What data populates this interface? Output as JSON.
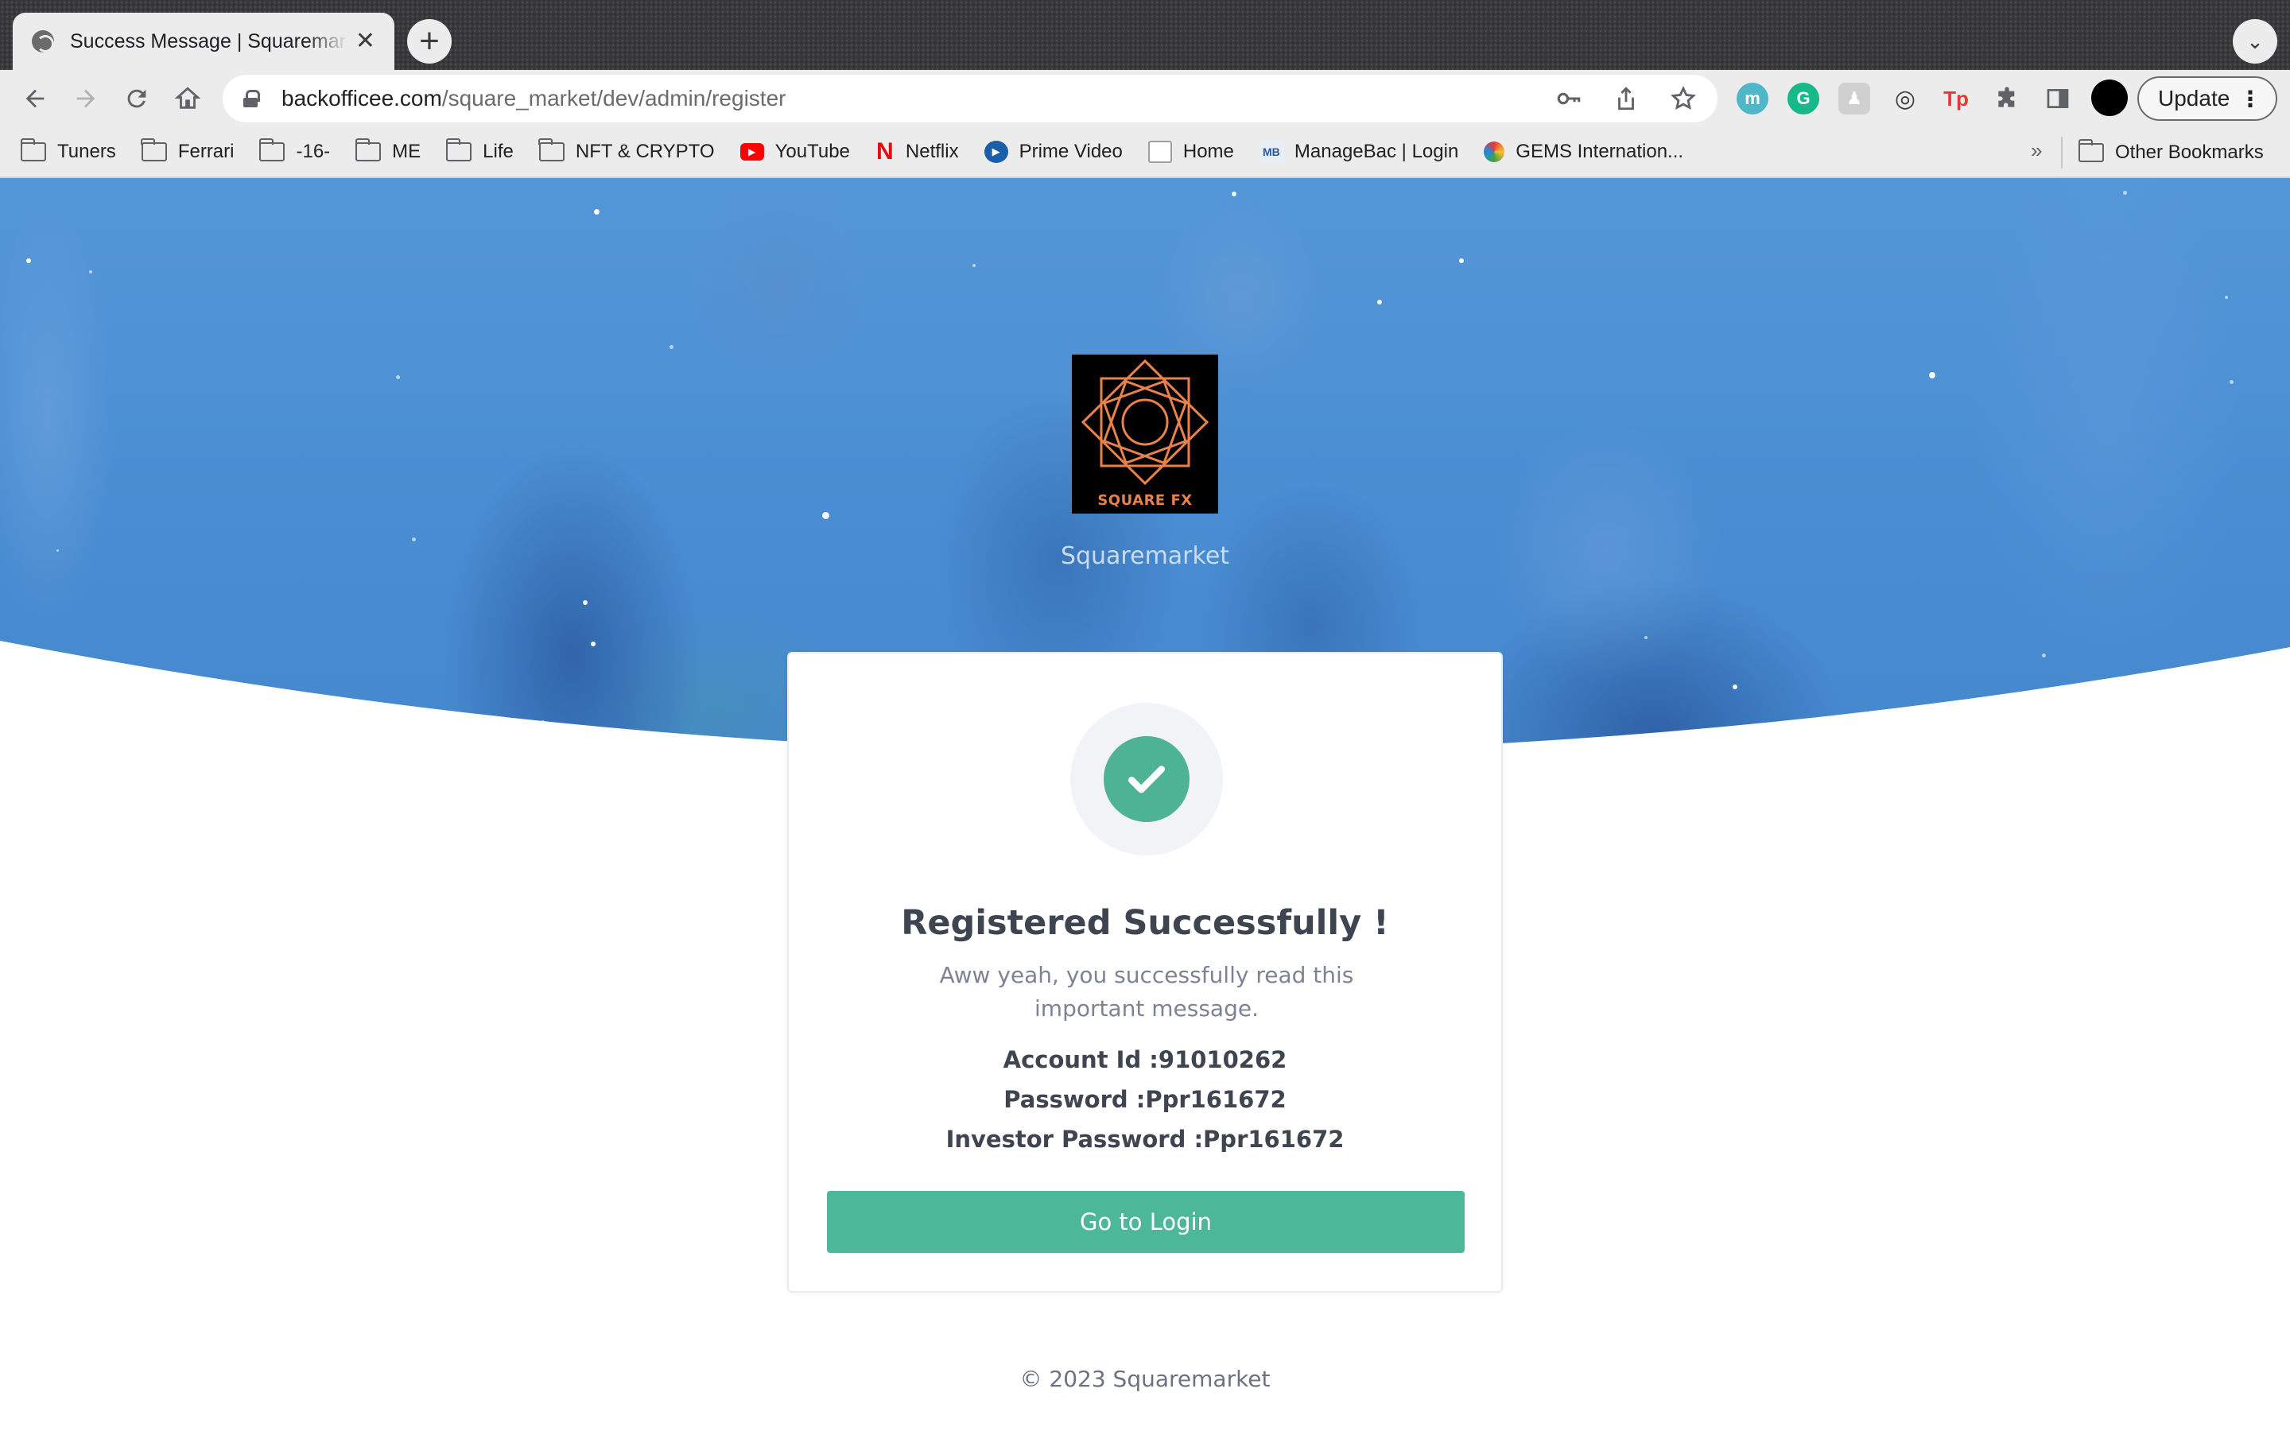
{
  "browser": {
    "tab_title": "Success Message | Squaremarket",
    "tab_close": "✕",
    "new_tab": "+",
    "tab_menu": "⌄",
    "url_host": "backofficee.com",
    "url_path": "/square_market/dev/admin/register",
    "update_label": "Update",
    "menu_dots": "⋮",
    "extensions": [
      {
        "name": "m",
        "color": "#4fb7c8"
      },
      {
        "name": "G",
        "color": "#17b889"
      },
      {
        "name": "♟",
        "color": "#9aa0a6"
      },
      {
        "name": "◎",
        "color": "#3c3c3c"
      },
      {
        "name": "Tp",
        "color": "#e53935"
      }
    ]
  },
  "bookmarks": {
    "items": [
      {
        "label": "Tuners",
        "icon": "folder-icon"
      },
      {
        "label": "Ferrari",
        "icon": "folder-icon"
      },
      {
        "label": "-16-",
        "icon": "folder-icon"
      },
      {
        "label": "ME",
        "icon": "folder-icon"
      },
      {
        "label": "Life",
        "icon": "folder-icon"
      },
      {
        "label": "NFT & CRYPTO",
        "icon": "folder-icon"
      },
      {
        "label": "YouTube",
        "icon": "youtube-icon"
      },
      {
        "label": "Netflix",
        "icon": "netflix-icon"
      },
      {
        "label": "Prime Video",
        "icon": "prime-video-icon"
      },
      {
        "label": "Home",
        "icon": "home-page-icon"
      },
      {
        "label": "ManageBac | Login",
        "icon": "managebac-icon"
      },
      {
        "label": "GEMS Internation...",
        "icon": "gems-icon"
      }
    ],
    "more": "»",
    "other": "Other Bookmarks"
  },
  "hero": {
    "logo_text": "SQUARE FX",
    "brand_name": "Squaremarket"
  },
  "card": {
    "title": "Registered Successfully !",
    "message": "Aww yeah, you successfully read this important message.",
    "account_id": "Account Id :91010262",
    "password": "Password :Ppr161672",
    "investor_password": "Investor Password :Ppr161672",
    "button_label": "Go to Login"
  },
  "footer": {
    "text": "© 2023 Squaremarket"
  },
  "colors": {
    "hero_blue": "#4a8fd4",
    "success_green": "#4db899",
    "title_text": "#3f4451",
    "logo_orange": "#e8824a"
  }
}
